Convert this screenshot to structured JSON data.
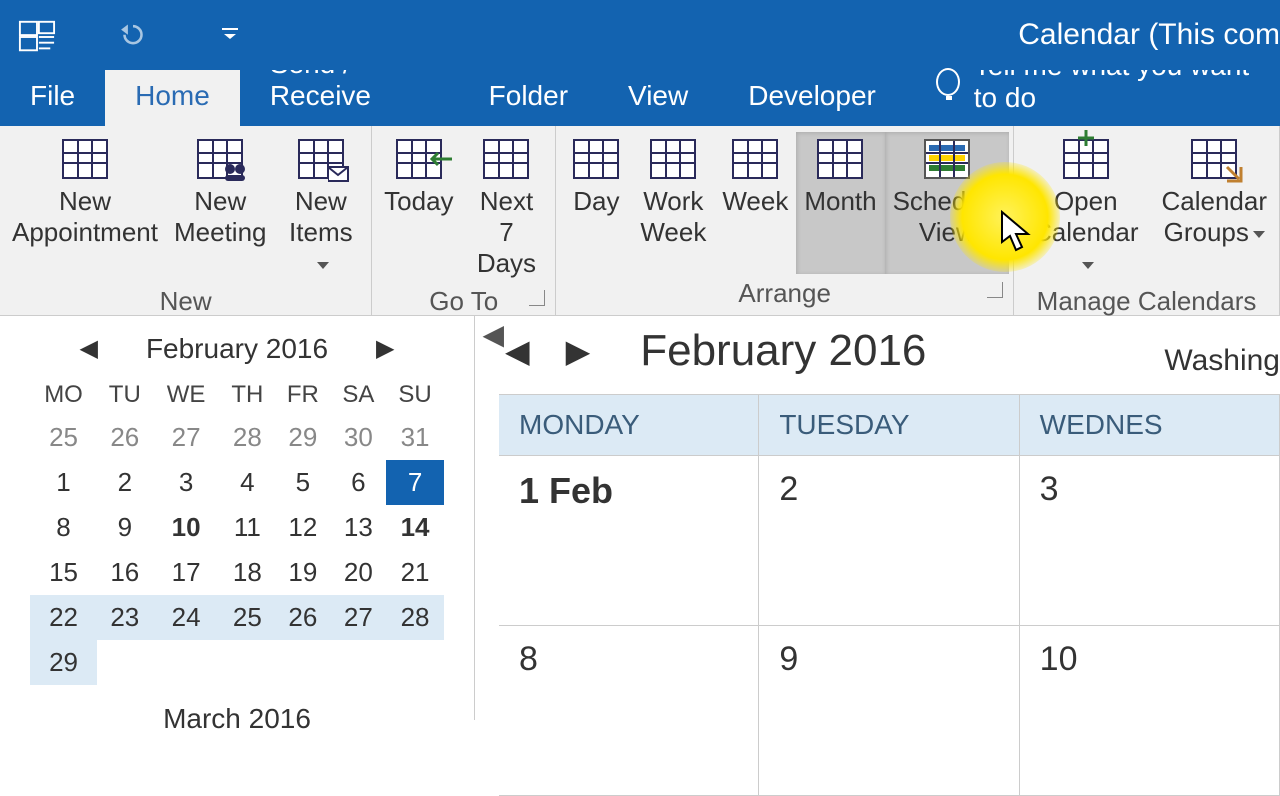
{
  "title": "Calendar (This com",
  "tabs": [
    "File",
    "Home",
    "Send / Receive",
    "Folder",
    "View",
    "Developer"
  ],
  "active_tab": 1,
  "tellme": "Tell me what you want to do",
  "ribbon": {
    "groups": [
      {
        "label": "New",
        "items": [
          {
            "label": "New\nAppointment",
            "name": "new-appointment-button",
            "dd": false
          },
          {
            "label": "New\nMeeting",
            "name": "new-meeting-button",
            "dd": false
          },
          {
            "label": "New\nItems",
            "name": "new-items-button",
            "dd": true
          }
        ]
      },
      {
        "label": "Go To",
        "dlg": true,
        "items": [
          {
            "label": "Today",
            "name": "today-button"
          },
          {
            "label": "Next 7\nDays",
            "name": "next7days-button"
          }
        ]
      },
      {
        "label": "Arrange",
        "dlg": true,
        "items": [
          {
            "label": "Day",
            "name": "day-button"
          },
          {
            "label": "Work\nWeek",
            "name": "workweek-button"
          },
          {
            "label": "Week",
            "name": "week-button"
          },
          {
            "label": "Month",
            "name": "month-button",
            "pressed": true
          },
          {
            "label": "Schedule\nView",
            "name": "scheduleview-button",
            "pressed": true
          }
        ]
      },
      {
        "label": "Manage Calendars",
        "items": [
          {
            "label": "Open\nCalendar",
            "name": "open-calendar-button",
            "dd": true
          },
          {
            "label": "Calendar\nGroups",
            "name": "calendar-groups-button",
            "dd": true
          }
        ]
      }
    ]
  },
  "mini": {
    "title": "February 2016",
    "dows": [
      "MO",
      "TU",
      "WE",
      "TH",
      "FR",
      "SA",
      "SU"
    ],
    "rows": [
      {
        "cells": [
          "25",
          "26",
          "27",
          "28",
          "29",
          "30",
          "31"
        ],
        "other": true
      },
      {
        "cells": [
          "1",
          "2",
          "3",
          "4",
          "5",
          "6",
          "7"
        ],
        "sel": 6
      },
      {
        "cells": [
          "8",
          "9",
          "10",
          "11",
          "12",
          "13",
          "14"
        ],
        "bold": [
          2,
          6
        ]
      },
      {
        "cells": [
          "15",
          "16",
          "17",
          "18",
          "19",
          "20",
          "21"
        ]
      },
      {
        "cells": [
          "22",
          "23",
          "24",
          "25",
          "26",
          "27",
          "28"
        ],
        "lastweek": true
      },
      {
        "cells": [
          "29",
          "",
          "",
          "",
          "",
          "",
          ""
        ],
        "lastweek": true
      }
    ],
    "next": "March 2016"
  },
  "main": {
    "title": "February 2016",
    "location": "Washing",
    "headers": [
      "MONDAY",
      "TUESDAY",
      "WEDNES"
    ],
    "rows": [
      [
        "1 Feb",
        "2",
        "3"
      ],
      [
        "8",
        "9",
        "10"
      ]
    ]
  }
}
